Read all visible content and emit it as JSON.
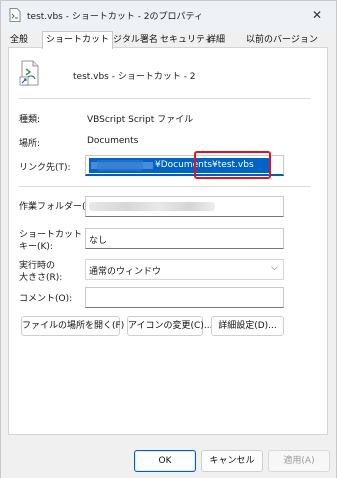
{
  "window": {
    "title": "test.vbs - ショートカット - 2のプロパティ",
    "close_glyph": "✕"
  },
  "tabs": [
    {
      "label": "全般"
    },
    {
      "label": "ショートカット"
    },
    {
      "label": "デジタル署名"
    },
    {
      "label": "セキュリティ"
    },
    {
      "label": "詳細"
    },
    {
      "label": "以前のバージョン"
    }
  ],
  "active_tab": "ショートカット",
  "header": {
    "shortcut_name": "test.vbs - ショートカット - 2"
  },
  "fields": {
    "type_label": "種類:",
    "type_value": "VBScript Script ファイル",
    "location_label": "場所:",
    "location_value": "Documents",
    "target_label": "リンク先(T):",
    "target_value": "¥Documents¥test.vbs",
    "startin_label": "作業フォルダー(S):",
    "hotkey_label_1": "ショートカット",
    "hotkey_label_2": "キー(K):",
    "hotkey_value": "なし",
    "run_label_1": "実行時の",
    "run_label_2": "大きさ(R):",
    "run_value": "通常のウィンドウ",
    "comment_label": "コメント(O):",
    "comment_value": ""
  },
  "buttons": {
    "open_location": "ファイルの場所を開く(F)",
    "change_icon": "アイコンの変更(C)...",
    "advanced": "詳細設定(D)...",
    "ok": "OK",
    "cancel": "キャンセル",
    "apply": "適用(A)"
  },
  "colors": {
    "selection": "#0063c6",
    "highlight_box": "#e0141e",
    "accent": "#005fb8"
  }
}
